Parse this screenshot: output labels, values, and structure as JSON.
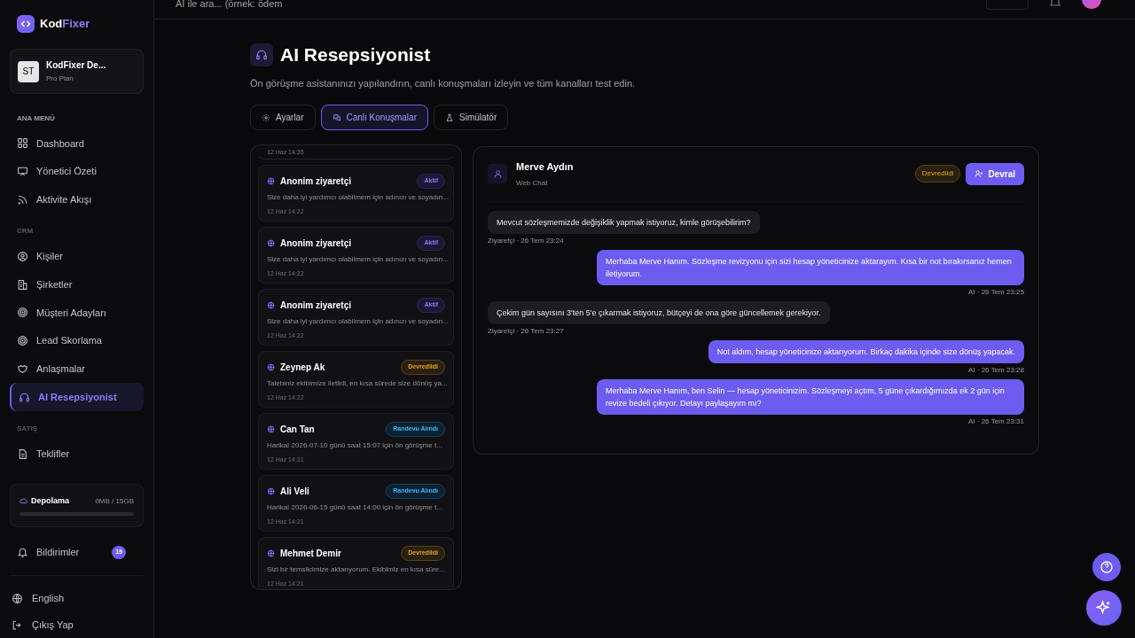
{
  "topbar": {
    "search_placeholder": "AI ile ara... (örnek: ödem"
  },
  "brand": {
    "name_a": "Kod",
    "name_b": "Fixer"
  },
  "workspace": {
    "initials": "ST",
    "name": "KodFixer De...",
    "plan": "Pro Plan"
  },
  "sidebar": {
    "sections": [
      {
        "title": "ANA MENÜ",
        "items": [
          {
            "label": "Dashboard",
            "selected": false
          },
          {
            "label": "Yönetici Özeti",
            "selected": false
          },
          {
            "label": "Aktivite Akışı",
            "selected": false
          }
        ]
      },
      {
        "title": "CRM",
        "items": [
          {
            "label": "Kişiler",
            "selected": false
          },
          {
            "label": "Şirketler",
            "selected": false
          },
          {
            "label": "Müşteri Adayları",
            "selected": false
          },
          {
            "label": "Lead Skorlama",
            "selected": false
          },
          {
            "label": "Anlaşmalar",
            "selected": false
          },
          {
            "label": "AI Resepsiyonist",
            "selected": true
          }
        ]
      },
      {
        "title": "SATIŞ",
        "items": [
          {
            "label": "Teklifler",
            "selected": false
          }
        ]
      }
    ],
    "storage": {
      "label": "Depolama",
      "usage": "0MB / 15GB",
      "level": 0
    },
    "notifications": {
      "label": "Bildirimler",
      "count": "19"
    },
    "language": "English",
    "logout": "Çıkış Yap"
  },
  "page": {
    "title": "AI Resepsiyonist",
    "subtitle": "Ön görüşme asistanınızı yapılandırın, canlı konuşmaları izleyin ve tüm kanalları test edin.",
    "tabs": [
      {
        "label": "Ayarlar",
        "selected": false
      },
      {
        "label": "Canlı Konuşmalar",
        "selected": true
      },
      {
        "label": "Simülatör",
        "selected": false
      }
    ]
  },
  "conversations": {
    "partial_time": "12 Haz 14:35",
    "items": [
      {
        "name": "Anonim ziyaretçi",
        "status": "Aktif",
        "kind": "active",
        "preview": "Size daha iyi yardımcı olabilmem için adınızı ve soyadın...",
        "time": "12 Haz 14:22"
      },
      {
        "name": "Anonim ziyaretçi",
        "status": "Aktif",
        "kind": "active",
        "preview": "Size daha iyi yardımcı olabilmem için adınızı ve soyadın...",
        "time": "12 Haz 14:22"
      },
      {
        "name": "Anonim ziyaretçi",
        "status": "Aktif",
        "kind": "active",
        "preview": "Size daha iyi yardımcı olabilmem için adınızı ve soyadın...",
        "time": "12 Haz 14:22"
      },
      {
        "name": "Zeynep Ak",
        "status": "Devredildi",
        "kind": "handed_off",
        "preview": "Talebiniz ekibimize iletildi, en kısa sürede size dönüş ya...",
        "time": "12 Haz 14:22"
      },
      {
        "name": "Can Tan",
        "status": "Randevu Alındı",
        "kind": "booked",
        "preview": "Harika! 2026-07-10 günü saat 15:07 için ön görüşme t...",
        "time": "12 Haz 14:21"
      },
      {
        "name": "Ali Veli",
        "status": "Randevu Alındı",
        "kind": "booked",
        "preview": "Harika! 2026-06-15 günü saat 14:00 için ön görüşme t...",
        "time": "12 Haz 14:21"
      },
      {
        "name": "Mehmet Demir",
        "status": "Devredildi",
        "kind": "handed_off",
        "preview": "Sizi bir temsilcimize aktarıyorum. Ekibimiz en kısa süre...",
        "time": "12 Haz 14:21"
      }
    ]
  },
  "chat": {
    "name": "Merve Aydın",
    "channel": "Web Chat",
    "badge": {
      "label": "Devredildi",
      "kind": "handed_off"
    },
    "takeover": "Devral",
    "messages": [
      {
        "kind": "visitor",
        "text": "Mevcut sözleşmemizde değişiklik yapmak istiyoruz, kimle görüşebilirim?",
        "meta": "Ziyaretçi · 26 Tem 23:24"
      },
      {
        "kind": "ai",
        "text": "Merhaba Merve Hanım. Sözleşme revizyonu için sizi hesap yöneticinize aktarayım. Kısa bir not bırakırsanız hemen iletiyorum.",
        "meta": "AI · 26 Tem 23:25"
      },
      {
        "kind": "visitor",
        "text": "Çekim gün sayısını 3'ten 5'e çıkarmak istiyoruz, bütçeyi de ona göre güncellemek gerekiyor.",
        "meta": "Ziyaretçi · 26 Tem 23:27"
      },
      {
        "kind": "ai",
        "text": "Not aldım, hesap yöneticinize aktarıyorum. Birkaç dakika içinde size dönüş yapacak.",
        "meta": "AI · 26 Tem 23:28"
      },
      {
        "kind": "ai",
        "text": "Merhaba Merve Hanım, ben Selin — hesap yöneticinizim. Sözleşmeyi açtım, 5 güne çıkardığımızda ek 2 gün için revize bedeli çıkıyor. Detayı paylaşayım mı?",
        "meta": "AI · 26 Tem 23:31"
      }
    ]
  }
}
